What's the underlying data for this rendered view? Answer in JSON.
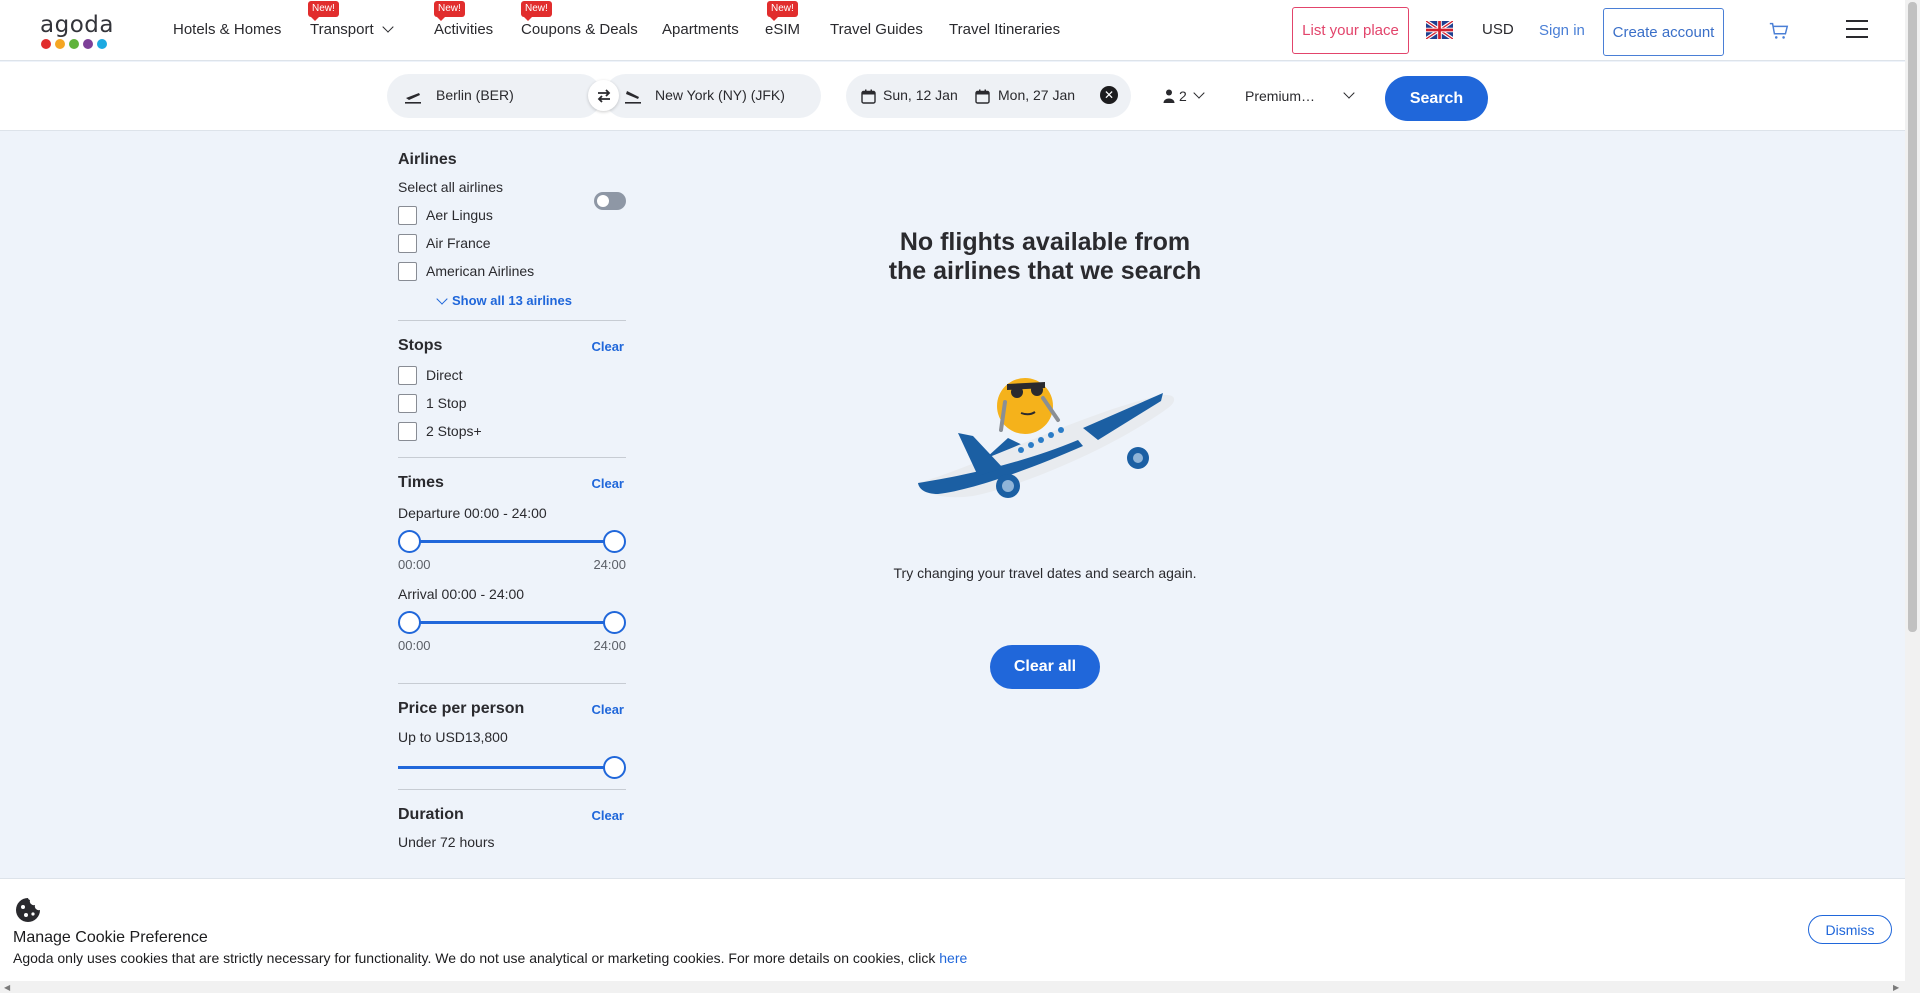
{
  "header": {
    "logo_text": "agoda",
    "logo_colors": [
      "#e12d2d",
      "#f5a623",
      "#5fb33b",
      "#7d3f98",
      "#1ca9e1"
    ],
    "nav": [
      {
        "label": "Hotels & Homes",
        "badge": ""
      },
      {
        "label": "Transport",
        "badge": "New!"
      },
      {
        "label": "Activities",
        "badge": "New!"
      },
      {
        "label": "Coupons & Deals",
        "badge": "New!"
      },
      {
        "label": "Apartments",
        "badge": ""
      },
      {
        "label": "eSIM",
        "badge": "New!"
      },
      {
        "label": "Travel Guides",
        "badge": ""
      },
      {
        "label": "Travel Itineraries",
        "badge": ""
      }
    ],
    "list_place": "List your place",
    "language_icon": "uk-flag-icon",
    "currency": "USD",
    "sign_in": "Sign in",
    "create_account": "Create account",
    "cart_icon": "cart-icon",
    "menu_icon": "hamburger-icon"
  },
  "search": {
    "origin": "Berlin (BER)",
    "destination": "New York (NY) (JFK)",
    "depart_date": "Sun, 12 Jan",
    "return_date": "Mon, 27 Jan",
    "passengers": "2",
    "cabin": "Premium…",
    "button": "Search"
  },
  "filters": {
    "airlines": {
      "title": "Airlines",
      "select_all": "Select all airlines",
      "select_all_on": false,
      "items": [
        "Aer Lingus",
        "Air France",
        "American Airlines"
      ],
      "show_all": "Show all 13 airlines"
    },
    "stops": {
      "title": "Stops",
      "clear": "Clear",
      "items": [
        "Direct",
        "1 Stop",
        "2 Stops+"
      ]
    },
    "times": {
      "title": "Times",
      "clear": "Clear",
      "departure_label": "Departure 00:00 - 24:00",
      "departure_min": "00:00",
      "departure_max": "24:00",
      "arrival_label": "Arrival 00:00 - 24:00",
      "arrival_min": "00:00",
      "arrival_max": "24:00"
    },
    "price": {
      "title": "Price per person",
      "clear": "Clear",
      "label": "Up to USD13,800",
      "fill_fraction": 1.0
    },
    "duration": {
      "title": "Duration",
      "clear": "Clear",
      "label": "Under 72 hours"
    }
  },
  "empty_state": {
    "title": "No flights available from the airlines that we search",
    "subtitle": "Try changing your travel dates and search again.",
    "button": "Clear all"
  },
  "cookie": {
    "title": "Manage Cookie Preference",
    "text": "Agoda only uses cookies that are strictly necessary for functionality. We do not use analytical or marketing cookies. For more details on cookies, click",
    "link": "here",
    "dismiss": "Dismiss"
  },
  "colors": {
    "primary": "#2067da",
    "list_place": "#e2446b",
    "badge": "#e12d2d"
  }
}
